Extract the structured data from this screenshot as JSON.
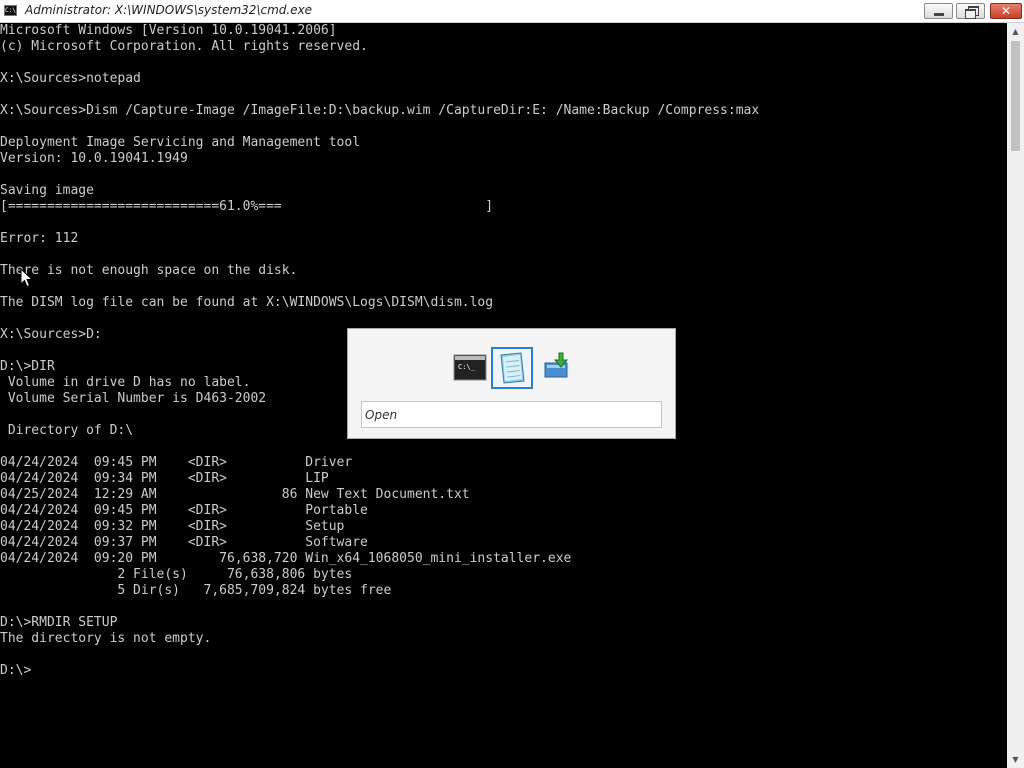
{
  "window": {
    "title": "Administrator: X:\\WINDOWS\\system32\\cmd.exe",
    "app_icon_glyph": "C:\\",
    "minimize_icon": "minimize-icon",
    "maximize_icon": "restore-icon",
    "close_label": "✕",
    "close_color": "#c4402a"
  },
  "console": {
    "background": "#000000",
    "foreground": "#cccccc",
    "lines": [
      "Microsoft Windows [Version 10.0.19041.2006]",
      "(c) Microsoft Corporation. All rights reserved.",
      "",
      "X:\\Sources>notepad",
      "",
      "X:\\Sources>Dism /Capture-Image /ImageFile:D:\\backup.wim /CaptureDir:E: /Name:Backup /Compress:max",
      "",
      "Deployment Image Servicing and Management tool",
      "Version: 10.0.19041.1949",
      "",
      "Saving image",
      "[===========================61.0%===                          ]",
      "",
      "Error: 112",
      "",
      "There is not enough space on the disk.",
      "",
      "The DISM log file can be found at X:\\WINDOWS\\Logs\\DISM\\dism.log",
      "",
      "X:\\Sources>D:",
      "",
      "D:\\>DIR",
      " Volume in drive D has no label.",
      " Volume Serial Number is D463-2002",
      "",
      " Directory of D:\\",
      "",
      "04/24/2024  09:45 PM    <DIR>          Driver",
      "04/24/2024  09:34 PM    <DIR>          LIP",
      "04/25/2024  12:29 AM                86 New Text Document.txt",
      "04/24/2024  09:45 PM    <DIR>          Portable",
      "04/24/2024  09:32 PM    <DIR>          Setup",
      "04/24/2024  09:37 PM    <DIR>          Software",
      "04/24/2024  09:20 PM        76,638,720 Win_x64_1068050_mini_installer.exe",
      "               2 File(s)     76,638,806 bytes",
      "               5 Dir(s)   7,685,709,824 bytes free",
      "",
      "D:\\>RMDIR SETUP",
      "The directory is not empty.",
      "",
      "D:\\>"
    ]
  },
  "scrollbar": {
    "up_arrow": "▲",
    "down_arrow": "▼"
  },
  "switcher": {
    "items": [
      {
        "icon": "command-prompt-icon",
        "selected": false
      },
      {
        "icon": "notepad-icon",
        "selected": true
      },
      {
        "icon": "setup-install-icon",
        "selected": false
      }
    ],
    "search_placeholder": "Open",
    "selection_color": "#2f7fc4"
  }
}
